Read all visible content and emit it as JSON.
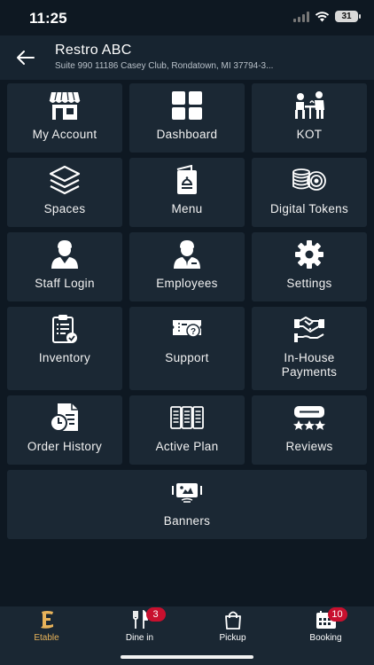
{
  "status": {
    "time": "11:25",
    "battery": "31"
  },
  "header": {
    "title": "Restro ABC",
    "address": "Suite 990 11186 Casey Club, Rondatown, MI 37794-3..."
  },
  "tiles": [
    {
      "label": "My Account",
      "icon": "store-icon"
    },
    {
      "label": "Dashboard",
      "icon": "dashboard-icon"
    },
    {
      "label": "KOT",
      "icon": "waiter-table-icon"
    },
    {
      "label": "Spaces",
      "icon": "layers-icon"
    },
    {
      "label": "Menu",
      "icon": "menu-book-icon"
    },
    {
      "label": "Digital Tokens",
      "icon": "coins-icon"
    },
    {
      "label": "Staff Login",
      "icon": "staff-icon"
    },
    {
      "label": "Employees",
      "icon": "employee-icon"
    },
    {
      "label": "Settings",
      "icon": "gear-icon"
    },
    {
      "label": "Inventory",
      "icon": "clipboard-icon"
    },
    {
      "label": "Support",
      "icon": "support-ticket-icon"
    },
    {
      "label": "In-House\nPayments",
      "label_line1": "In-House",
      "label_line2": "Payments",
      "icon": "handshake-icon"
    },
    {
      "label": "Order History",
      "icon": "order-history-icon"
    },
    {
      "label": "Active Plan",
      "icon": "plan-icon"
    },
    {
      "label": "Reviews",
      "icon": "reviews-icon"
    },
    {
      "label": "Banners",
      "icon": "banner-icon"
    }
  ],
  "bottom_nav": [
    {
      "label": "Etable",
      "icon": "etable-logo-icon",
      "active": true
    },
    {
      "label": "Dine in",
      "icon": "cutlery-icon",
      "badge": "3"
    },
    {
      "label": "Pickup",
      "icon": "bag-icon"
    },
    {
      "label": "Booking",
      "icon": "calendar-icon",
      "badge": "10"
    }
  ],
  "colors": {
    "background": "#0e1822",
    "tile": "#1b2834",
    "accent": "#e8b35a",
    "badge": "#c8102e"
  }
}
